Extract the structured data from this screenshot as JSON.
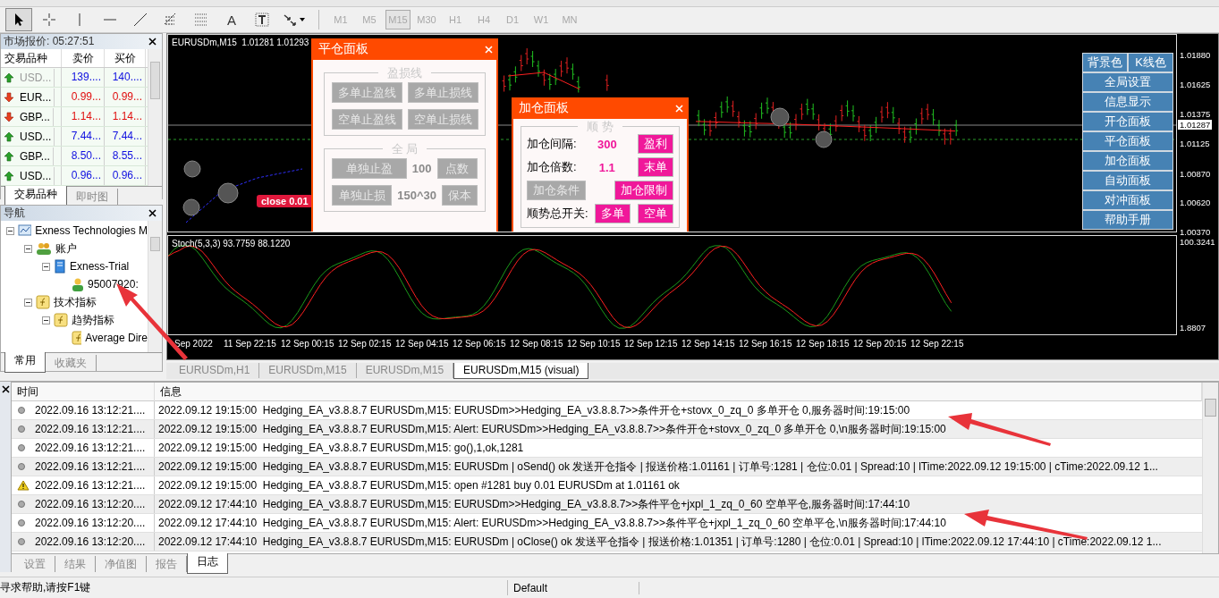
{
  "toolbar": {
    "tools": [
      {
        "kind": "cursor",
        "selected": true
      },
      {
        "kind": "crosshair",
        "selected": false
      },
      {
        "kind": "vline",
        "selected": false
      },
      {
        "kind": "hline",
        "selected": false
      },
      {
        "kind": "trendline",
        "selected": false
      },
      {
        "kind": "fibo",
        "selected": false
      },
      {
        "kind": "grid",
        "selected": false
      },
      {
        "kind": "text",
        "glyph": "A",
        "selected": false
      },
      {
        "kind": "label",
        "selected": false
      },
      {
        "kind": "arrows",
        "selected": false
      }
    ],
    "timeframes": [
      {
        "label": "M1",
        "selected": false,
        "disabled": true
      },
      {
        "label": "M5",
        "selected": false,
        "disabled": true
      },
      {
        "label": "M15",
        "selected": true,
        "disabled": true
      },
      {
        "label": "M30",
        "selected": false,
        "disabled": true
      },
      {
        "label": "H1",
        "selected": false,
        "disabled": true
      },
      {
        "label": "H4",
        "selected": false,
        "disabled": true
      },
      {
        "label": "D1",
        "selected": false,
        "disabled": true
      },
      {
        "label": "W1",
        "selected": false,
        "disabled": true
      },
      {
        "label": "MN",
        "selected": false,
        "disabled": true
      }
    ]
  },
  "market_watch": {
    "title": "市场报价: 05:27:51",
    "columns": [
      "交易品种",
      "卖价",
      "买价"
    ],
    "rows": [
      {
        "symbol": "USD...",
        "bid": "139....",
        "ask": "140....",
        "kind": "up",
        "dimmed": true
      },
      {
        "symbol": "EUR...",
        "bid": "0.99...",
        "ask": "0.99...",
        "kind": "down",
        "dimmed": false
      },
      {
        "symbol": "GBP...",
        "bid": "1.14...",
        "ask": "1.14...",
        "kind": "down",
        "dimmed": false
      },
      {
        "symbol": "USD...",
        "bid": "7.44...",
        "ask": "7.44...",
        "kind": "up",
        "dimmed": false
      },
      {
        "symbol": "GBP...",
        "bid": "8.50...",
        "ask": "8.55...",
        "kind": "up",
        "dimmed": false
      },
      {
        "symbol": "USD...",
        "bid": "0.96...",
        "ask": "0.96...",
        "kind": "up",
        "dimmed": false
      }
    ],
    "tabs": [
      {
        "label": "交易品种",
        "selected": true
      },
      {
        "label": "即时图",
        "selected": false
      }
    ]
  },
  "navigator": {
    "title": "导航",
    "tree": [
      {
        "label": "Exness Technologies M",
        "kind": "broker",
        "expanded": true,
        "children": [
          {
            "label": "账户",
            "kind": "accounts",
            "expanded": true,
            "children": [
              {
                "label": "Exness-Trial",
                "kind": "server",
                "expanded": true,
                "children": [
                  {
                    "label": "95007920:",
                    "kind": "user"
                  }
                ]
              }
            ]
          },
          {
            "label": "技术指标",
            "kind": "indicators",
            "expanded": true,
            "children": [
              {
                "label": "趋势指标",
                "kind": "indicators",
                "expanded": true,
                "children": [
                  {
                    "label": "Average Dire",
                    "kind": "indicators"
                  }
                ]
              }
            ]
          }
        ]
      }
    ],
    "tabs": [
      {
        "label": "常用",
        "selected": true
      },
      {
        "label": "收藏夹",
        "selected": false
      }
    ]
  },
  "chart": {
    "title": "EURUSDm,M15  1.01281 1.01293",
    "close_label": "close 0.01",
    "price_axis": [
      "1.01880",
      "1.01625",
      "1.01375",
      "1.01125",
      "1.00870",
      "1.00620",
      "1.00370"
    ],
    "current_price": "1.01287",
    "side_menu": {
      "top_row": [
        "背景色",
        "K线色"
      ],
      "items": [
        "全局设置",
        "信息显示",
        "开仓面板",
        "平仓面板",
        "加仓面板",
        "自动面板",
        "对冲面板",
        "帮助手册"
      ]
    },
    "close_panel": {
      "title": "平仓面板",
      "groups": [
        {
          "title": "盈损线",
          "rows": [
            [
              {
                "kind": "button",
                "label": "多单止盈线",
                "on": false
              },
              {
                "kind": "button",
                "label": "多单止损线",
                "on": false
              }
            ],
            [
              {
                "kind": "button",
                "label": "空单止盈线",
                "on": false
              },
              {
                "kind": "button",
                "label": "空单止损线",
                "on": false
              }
            ]
          ]
        },
        {
          "title": "全 局",
          "rows": [
            [
              {
                "kind": "button",
                "label": "单独止盈",
                "on": false
              },
              {
                "kind": "value",
                "label": "100",
                "on": false
              },
              {
                "kind": "button",
                "label": "点数",
                "on": false
              }
            ],
            [
              {
                "kind": "button",
                "label": "单独止损",
                "on": false
              },
              {
                "kind": "value",
                "label": "150^30",
                "on": false
              },
              {
                "kind": "button",
                "label": "保本",
                "on": false
              }
            ]
          ]
        }
      ]
    },
    "add_panel": {
      "title": "加仓面板",
      "groups": [
        {
          "title": "顺 势",
          "rows": [
            [
              {
                "kind": "label",
                "label": "加仓间隔:"
              },
              {
                "kind": "value",
                "label": "300",
                "on": true
              },
              {
                "kind": "button",
                "label": "盈利",
                "on": true
              }
            ],
            [
              {
                "kind": "label",
                "label": "加仓倍数:"
              },
              {
                "kind": "value",
                "label": "1.1",
                "on": true
              },
              {
                "kind": "button",
                "label": "末单",
                "on": true
              }
            ],
            [
              {
                "kind": "button",
                "label": "加仓条件",
                "on": false
              },
              {
                "kind": "button",
                "label": "加仓限制",
                "on": true
              }
            ],
            [
              {
                "kind": "label",
                "label": "顺势总开关:"
              },
              {
                "kind": "button",
                "label": "多单",
                "on": true
              },
              {
                "kind": "button",
                "label": "空单",
                "on": true
              }
            ]
          ]
        }
      ]
    },
    "indicator": {
      "label": "Stoch(5,3,3) 93.7759 88.1220",
      "axis": [
        "100.3241",
        "1.8807"
      ]
    },
    "time_axis": [
      "Sep 2022",
      "11 Sep 22:15",
      "12 Sep 00:15",
      "12 Sep 02:15",
      "12 Sep 04:15",
      "12 Sep 06:15",
      "12 Sep 08:15",
      "12 Sep 10:15",
      "12 Sep 12:15",
      "12 Sep 14:15",
      "12 Sep 16:15",
      "12 Sep 18:15",
      "12 Sep 20:15",
      "12 Sep 22:15"
    ]
  },
  "chart_tabs": [
    {
      "label": "EURUSDm,H1",
      "selected": false
    },
    {
      "label": "EURUSDm,M15",
      "selected": false
    },
    {
      "label": "EURUSDm,M15",
      "selected": false
    },
    {
      "label": "EURUSDm,M15 (visual)",
      "selected": true
    }
  ],
  "terminal": {
    "columns": [
      "时间",
      "信息"
    ],
    "rows": [
      {
        "kind": "info",
        "time": "2022.09.16 13:12:21....",
        "message": "2022.09.12 19:15:00  Hedging_EA_v3.8.8.7 EURUSDm,M15: EURUSDm>>Hedging_EA_v3.8.8.7>>条件开仓+stovx_0_zq_0 多单开仓 0,服务器时间:19:15:00"
      },
      {
        "kind": "info",
        "time": "2022.09.16 13:12:21....",
        "message": "2022.09.12 19:15:00  Hedging_EA_v3.8.8.7 EURUSDm,M15: Alert: EURUSDm>>Hedging_EA_v3.8.8.7>>条件开仓+stovx_0_zq_0 多单开仓 0,\\n服务器时间:19:15:00"
      },
      {
        "kind": "info",
        "time": "2022.09.16 13:12:21....",
        "message": "2022.09.12 19:15:00  Hedging_EA_v3.8.8.7 EURUSDm,M15: go(),1,ok,1281"
      },
      {
        "kind": "info",
        "time": "2022.09.16 13:12:21....",
        "message": "2022.09.12 19:15:00  Hedging_EA_v3.8.8.7 EURUSDm,M15: EURUSDm | oSend() ok 发送开仓指令 | 报送价格:1.01161 | 订单号:1281 | 仓位:0.01 | Spread:10 | lTime:2022.09.12 19:15:00 | cTime:2022.09.12 1..."
      },
      {
        "kind": "warning",
        "time": "2022.09.16 13:12:21....",
        "message": "2022.09.12 19:15:00  Hedging_EA_v3.8.8.7 EURUSDm,M15: open #1281 buy 0.01 EURUSDm at 1.01161 ok"
      },
      {
        "kind": "info",
        "time": "2022.09.16 13:12:20....",
        "message": "2022.09.12 17:44:10  Hedging_EA_v3.8.8.7 EURUSDm,M15: EURUSDm>>Hedging_EA_v3.8.8.7>>条件平仓+jxpl_1_zq_0_60 空单平仓,服务器时间:17:44:10"
      },
      {
        "kind": "info",
        "time": "2022.09.16 13:12:20....",
        "message": "2022.09.12 17:44:10  Hedging_EA_v3.8.8.7 EURUSDm,M15: Alert: EURUSDm>>Hedging_EA_v3.8.8.7>>条件平仓+jxpl_1_zq_0_60 空单平仓,\\n服务器时间:17:44:10"
      },
      {
        "kind": "info",
        "time": "2022.09.16 13:12:20....",
        "message": "2022.09.12 17:44:10  Hedging_EA_v3.8.8.7 EURUSDm,M15: EURUSDm | oClose() ok 发送平仓指令 | 报送价格:1.01351 | 订单号:1280 | 仓位:0.01 | Spread:10 | lTime:2022.09.12 17:44:10 | cTime:2022.09.12 1..."
      }
    ],
    "tabs": [
      {
        "label": "设置",
        "selected": false
      },
      {
        "label": "结果",
        "selected": false
      },
      {
        "label": "净值图",
        "selected": false
      },
      {
        "label": "报告",
        "selected": false
      },
      {
        "label": "日志",
        "selected": true
      }
    ]
  },
  "status_bar": {
    "help": "寻求帮助,请按F1键",
    "profile": "Default"
  }
}
